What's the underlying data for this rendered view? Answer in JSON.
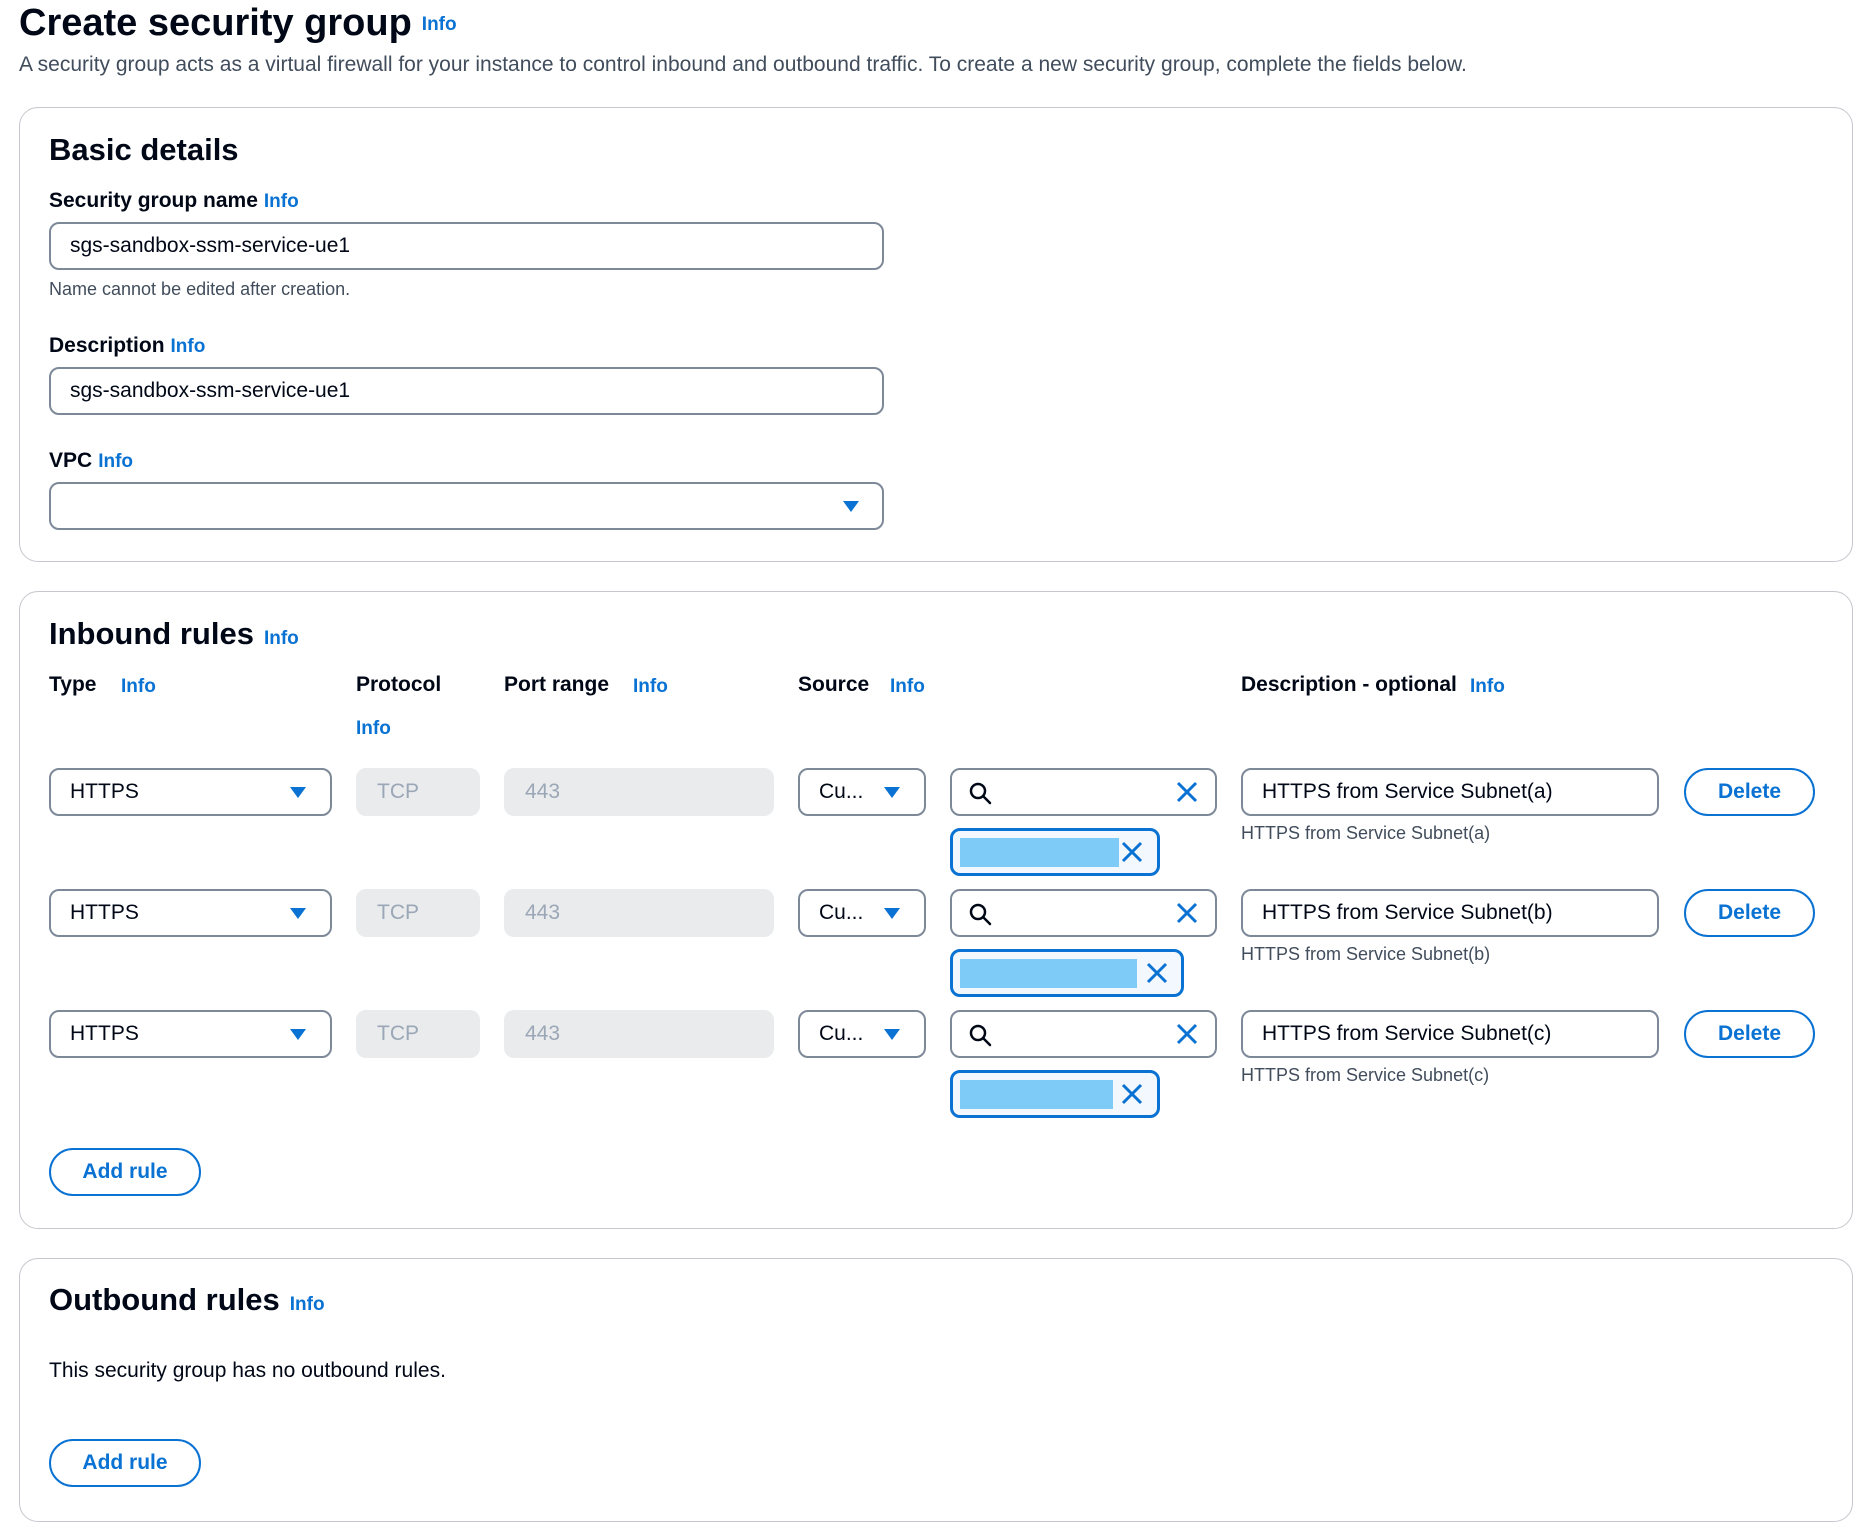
{
  "page": {
    "title": "Create security group",
    "info": "Info",
    "description": "A security group acts as a virtual firewall for your instance to control inbound and outbound traffic. To create a new security group, complete the fields below."
  },
  "basic_details": {
    "title": "Basic details",
    "name_label": "Security group name",
    "name_value": "sgs-sandbox-ssm-service-ue1",
    "name_hint": "Name cannot be edited after creation.",
    "description_label": "Description",
    "description_value": "sgs-sandbox-ssm-service-ue1",
    "vpc_label": "VPC",
    "vpc_value": ""
  },
  "inbound": {
    "title": "Inbound rules",
    "headers": {
      "type": "Type",
      "protocol": "Protocol",
      "port_range": "Port range",
      "source": "Source",
      "description": "Description - optional"
    },
    "rules": [
      {
        "type": "HTTPS",
        "protocol": "TCP",
        "port": "443",
        "source_type": "Cu...",
        "description": "HTTPS from Service Subnet(a)",
        "hint": "HTTPS from Service Subnet(a)",
        "delete_label": "Delete"
      },
      {
        "type": "HTTPS",
        "protocol": "TCP",
        "port": "443",
        "source_type": "Cu...",
        "description": "HTTPS from Service Subnet(b)",
        "hint": "HTTPS from Service Subnet(b)",
        "delete_label": "Delete"
      },
      {
        "type": "HTTPS",
        "protocol": "TCP",
        "port": "443",
        "source_type": "Cu...",
        "description": "HTTPS from Service Subnet(c)",
        "hint": "HTTPS from Service Subnet(c)",
        "delete_label": "Delete"
      }
    ],
    "add_rule_label": "Add rule"
  },
  "outbound": {
    "title": "Outbound rules",
    "empty_text": "This security group has no outbound rules.",
    "add_rule_label": "Add rule"
  },
  "colors": {
    "accent": "#0972d3",
    "token_fill": "#7fcbf8",
    "border": "#7d8998",
    "disabled_bg": "#e9ebed"
  },
  "icons": [
    "caret-down-icon",
    "search-icon",
    "close-icon"
  ]
}
